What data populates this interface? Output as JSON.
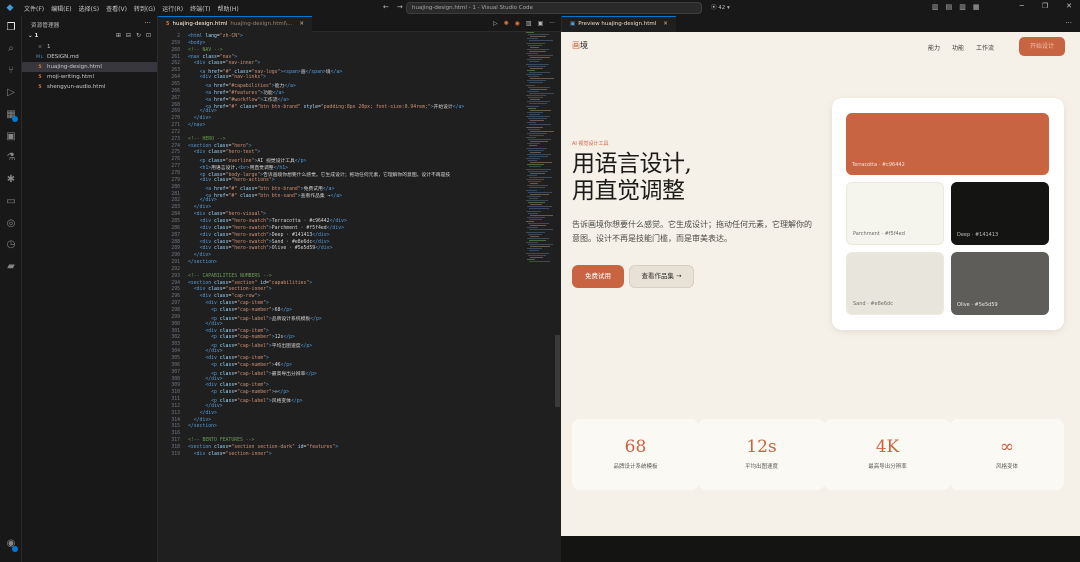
{
  "window": {
    "menu": [
      "文件(F)",
      "编辑(E)",
      "选择(S)",
      "查看(V)",
      "转到(G)",
      "运行(R)",
      "终端(T)",
      "帮助(H)"
    ],
    "command_center": "huajing-design.html - 1 - Visual Studio Code",
    "badge": "42"
  },
  "explorer": {
    "title": "资源管理器",
    "folder": "1",
    "files": [
      {
        "name": "1",
        "type": "plain"
      },
      {
        "name": "DESIGN.md",
        "type": "md"
      },
      {
        "name": "huajing-design.html",
        "type": "html",
        "active": true
      },
      {
        "name": "moji-writing.html",
        "type": "html"
      },
      {
        "name": "shengyun-audio.html",
        "type": "html"
      }
    ]
  },
  "editor": {
    "tab_name": "huajing-design.html",
    "tab_path": "huajing-design.html\\...",
    "lines": [
      {
        "n": "2",
        "t": "<html lang=\"zh-CN\">"
      },
      {
        "n": "259",
        "t": "<body>"
      },
      {
        "n": "260",
        "t": "<!-- NAV -->"
      },
      {
        "n": "261",
        "t": "<nav class=\"nav\">"
      },
      {
        "n": "262",
        "t": "  <div class=\"nav-inner\">"
      },
      {
        "n": "263",
        "t": "    <a href=\"#\" class=\"nav-logo\"><span>画</span>境</a>"
      },
      {
        "n": "264",
        "t": "    <div class=\"nav-links\">"
      },
      {
        "n": "265",
        "t": "      <a href=\"#capabilities\">能力</a>"
      },
      {
        "n": "266",
        "t": "      <a href=\"#features\">功能</a>"
      },
      {
        "n": "267",
        "t": "      <a href=\"#workflow\">工作流</a>"
      },
      {
        "n": "268",
        "t": "      <a href=\"#\" class=\"btn btn-brand\" style=\"padding:8px 20px; font-size:0.94rem;\">开始设计</a>"
      },
      {
        "n": "269",
        "t": "    </div>"
      },
      {
        "n": "270",
        "t": "  </div>"
      },
      {
        "n": "271",
        "t": "</nav>"
      },
      {
        "n": "272",
        "t": ""
      },
      {
        "n": "273",
        "t": "<!-- HERO -->"
      },
      {
        "n": "274",
        "t": "<section class=\"hero\">"
      },
      {
        "n": "275",
        "t": "  <div class=\"hero-text\">"
      },
      {
        "n": "276",
        "t": "    <p class=\"overline\">AI 视觉设计工具</p>"
      },
      {
        "n": "277",
        "t": "    <h1>用语言设计,<br>用直觉调整</h1>"
      },
      {
        "n": "278",
        "t": "    <p class=\"body-large\">告诉画境你想要什么感觉。它生成设计；拖动任何元素，它理解你的意图。设计不再是技"
      },
      {
        "n": "279",
        "t": "    <div class=\"hero-actions\">"
      },
      {
        "n": "280",
        "t": "      <a href=\"#\" class=\"btn btn-brand\">免费试用</a>"
      },
      {
        "n": "281",
        "t": "      <a href=\"#\" class=\"btn btn-sand\">查看作品集 →</a>"
      },
      {
        "n": "282",
        "t": "    </div>"
      },
      {
        "n": "283",
        "t": "  </div>"
      },
      {
        "n": "284",
        "t": "  <div class=\"hero-visual\">"
      },
      {
        "n": "285",
        "t": "    <div class=\"hero-swatch\">Terracotta · #c96442</div>"
      },
      {
        "n": "286",
        "t": "    <div class=\"hero-swatch\">Parchment · #f5f4ed</div>"
      },
      {
        "n": "287",
        "t": "    <div class=\"hero-swatch\">Deep · #141413</div>"
      },
      {
        "n": "288",
        "t": "    <div class=\"hero-swatch\">Sand · #e8e6dc</div>"
      },
      {
        "n": "289",
        "t": "    <div class=\"hero-swatch\">Olive · #5e5d59</div>"
      },
      {
        "n": "290",
        "t": "  </div>"
      },
      {
        "n": "291",
        "t": "</section>"
      },
      {
        "n": "292",
        "t": ""
      },
      {
        "n": "293",
        "t": "<!-- CAPABILITIES NUMBERS -->"
      },
      {
        "n": "294",
        "t": "<section class=\"section\" id=\"capabilities\">"
      },
      {
        "n": "295",
        "t": "  <div class=\"section-inner\">"
      },
      {
        "n": "296",
        "t": "    <div class=\"cap-row\">"
      },
      {
        "n": "297",
        "t": "      <div class=\"cap-item\">"
      },
      {
        "n": "298",
        "t": "        <p class=\"cap-number\">68</p>"
      },
      {
        "n": "299",
        "t": "        <p class=\"cap-label\">品牌设计系统模板</p>"
      },
      {
        "n": "300",
        "t": "      </div>"
      },
      {
        "n": "301",
        "t": "      <div class=\"cap-item\">"
      },
      {
        "n": "302",
        "t": "        <p class=\"cap-number\">12s</p>"
      },
      {
        "n": "303",
        "t": "        <p class=\"cap-label\">平均出图速度</p>"
      },
      {
        "n": "304",
        "t": "      </div>"
      },
      {
        "n": "305",
        "t": "      <div class=\"cap-item\">"
      },
      {
        "n": "306",
        "t": "        <p class=\"cap-number\">4K</p>"
      },
      {
        "n": "307",
        "t": "        <p class=\"cap-label\">最高导出分辨率</p>"
      },
      {
        "n": "308",
        "t": "      </div>"
      },
      {
        "n": "309",
        "t": "      <div class=\"cap-item\">"
      },
      {
        "n": "310",
        "t": "        <p class=\"cap-number\">∞</p>"
      },
      {
        "n": "311",
        "t": "        <p class=\"cap-label\">风格变体</p>"
      },
      {
        "n": "312",
        "t": "      </div>"
      },
      {
        "n": "313",
        "t": "    </div>"
      },
      {
        "n": "314",
        "t": "  </div>"
      },
      {
        "n": "315",
        "t": "</section>"
      },
      {
        "n": "316",
        "t": ""
      },
      {
        "n": "317",
        "t": "<!-- BENTO FEATURES -->"
      },
      {
        "n": "318",
        "t": "<section class=\"section section-dark\" id=\"features\">"
      },
      {
        "n": "319",
        "t": "  <div class=\"section-inner\">"
      }
    ]
  },
  "preview": {
    "tab_name": "Preview huajing-design.html",
    "logo_mark": "画",
    "logo_rest": "境",
    "nav_links": [
      "能力",
      "功能",
      "工作流"
    ],
    "nav_button": "开始设计",
    "overline": "AI 视觉设计工具",
    "hero_line1": "用语言设计,",
    "hero_line2": "用直觉调整",
    "hero_body": "告诉画境你想要什么感觉。它生成设计；拖动任何元素，它理解你的意图。设计不再是技能门槛，而是审美表达。",
    "btn_primary": "免费试用",
    "btn_secondary": "查看作品集 →",
    "swatches": [
      {
        "label": "Terracotta · #c96442",
        "color": "#c96442",
        "text_color": "#f6e3d8"
      },
      {
        "label": "Parchment · #f5f4ed",
        "color": "#f5f4ed",
        "text_color": "#6a6a66"
      },
      {
        "label": "Deep · #141413",
        "color": "#141413",
        "text_color": "#bdbdb8"
      },
      {
        "label": "Sand · #e8e6dc",
        "color": "#e8e6dc",
        "text_color": "#6a6a66"
      },
      {
        "label": "Olive · #5e5d59",
        "color": "#5e5d59",
        "text_color": "#e8e8e4"
      }
    ],
    "capabilities": [
      {
        "number": "68",
        "label": "品牌设计系统模板"
      },
      {
        "number": "12s",
        "label": "平均出图速度"
      },
      {
        "number": "4K",
        "label": "最高导出分辨率"
      },
      {
        "number": "∞",
        "label": "风格变体"
      }
    ]
  },
  "colors": {
    "brand": "#c96442",
    "vscode_accent": "#0078d4"
  }
}
